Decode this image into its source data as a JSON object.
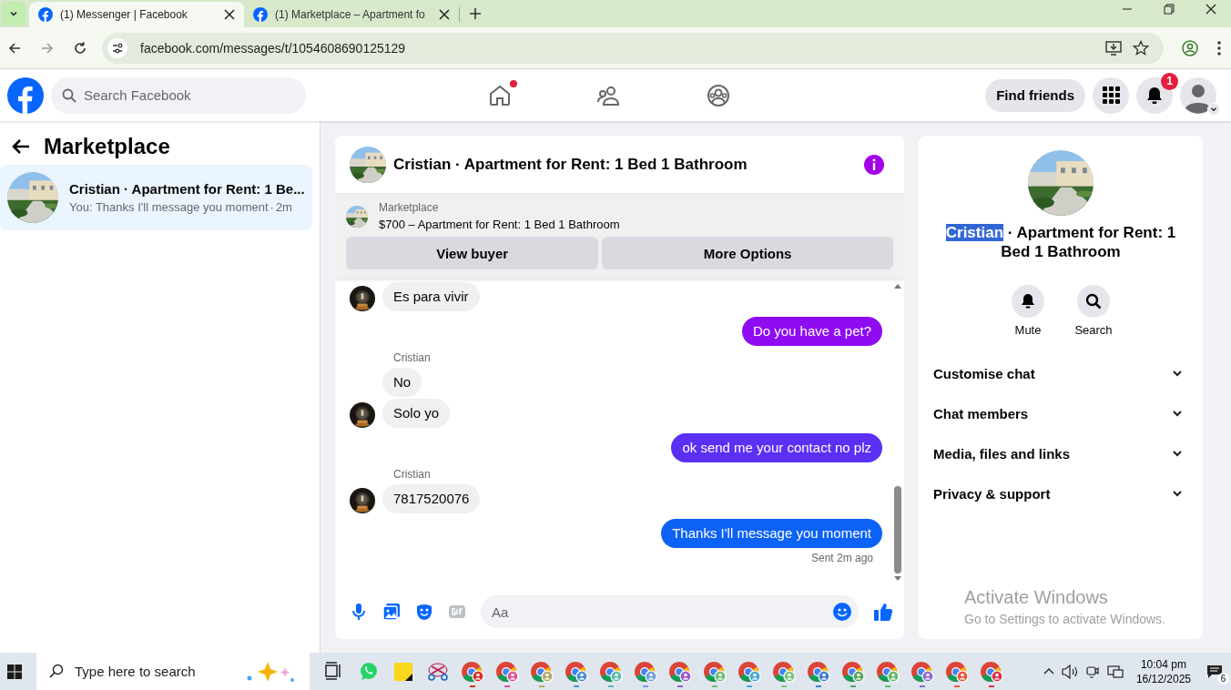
{
  "browser": {
    "tabs": [
      {
        "title": "(1) Messenger | Facebook",
        "selected": true
      },
      {
        "title": "(1) Marketplace – Apartment fo",
        "selected": false
      }
    ],
    "url": "facebook.com/messages/t/1054608690125129"
  },
  "header": {
    "search_placeholder": "Search Facebook",
    "nav": [
      {
        "kind": "home",
        "dot": true
      },
      {
        "kind": "friends",
        "dot": false
      },
      {
        "kind": "groups",
        "dot": false
      }
    ],
    "find_friends": "Find friends",
    "notification_count": "1"
  },
  "sidebar": {
    "title": "Marketplace",
    "conversations": [
      {
        "name": "Cristian · Apartment for Rent: 1 Be...",
        "preview": "You: Thanks I'll message you moment",
        "separator": "·",
        "time": "2m",
        "selected": true
      }
    ]
  },
  "chat": {
    "title": "Cristian · Apartment for Rent: 1 Bed 1 Bathroom",
    "listing": {
      "label": "Marketplace",
      "title": "$700 – Apartment for Rent: 1 Bed 1 Bathroom"
    },
    "buttons": [
      "View buyer",
      "More Options"
    ],
    "messages": [
      {
        "kind": "in",
        "text": "Es para vivir",
        "avatar": true
      },
      {
        "kind": "out",
        "text": "Do you have a pet?",
        "color": "#8f0cf2"
      },
      {
        "kind": "in",
        "sender": "Cristian",
        "text": "No",
        "avatar": false
      },
      {
        "kind": "in",
        "text": "Solo yo",
        "avatar": true
      },
      {
        "kind": "out",
        "text": "ok send me your contact no plz",
        "color": "#5b30f4"
      },
      {
        "kind": "in",
        "sender": "Cristian",
        "text": "7817520076",
        "avatar": true
      },
      {
        "kind": "out",
        "text": "Thanks I'll message you moment",
        "color": "#0d62f6"
      }
    ],
    "sent_status": "Sent 2m ago",
    "composer_placeholder": "Aa"
  },
  "info_panel": {
    "name": "Cristian",
    "name_selected": true,
    "title_rest": " · Apartment for Rent: 1 Bed 1 Bathroom",
    "actions": [
      {
        "kind": "mute",
        "label": "Mute"
      },
      {
        "kind": "search",
        "label": "Search"
      }
    ],
    "sections": [
      {
        "label": "Customise chat",
        "expanded": false
      },
      {
        "label": "Chat members",
        "expanded": false
      },
      {
        "label": "Media, files and links",
        "expanded": false
      },
      {
        "label": "Privacy & support",
        "expanded": false
      }
    ]
  },
  "system_notice": {
    "title": "Activate Windows",
    "text": "Go to Settings to activate Windows."
  },
  "taskbar": {
    "search_placeholder": "Type here to search",
    "apps": [
      {
        "kind": "taskview"
      },
      {
        "kind": "whatsapp"
      },
      {
        "kind": "notes"
      },
      {
        "kind": "snip"
      },
      {
        "kind": "chrome",
        "color": "#d93025"
      },
      {
        "kind": "chrome",
        "color": "#e05299"
      },
      {
        "kind": "chrome",
        "color": "#b8a86a"
      },
      {
        "kind": "chrome",
        "color": "#4a90d9"
      },
      {
        "kind": "chrome",
        "color": "#5fb8b0"
      },
      {
        "kind": "chrome",
        "color": "#6f9fe0"
      },
      {
        "kind": "chrome",
        "color": "#9b59d0"
      },
      {
        "kind": "chrome",
        "color": "#6fbf73"
      },
      {
        "kind": "chrome",
        "color": "#4aa8d8"
      },
      {
        "kind": "chrome",
        "color": "#7cc67f"
      },
      {
        "kind": "chrome",
        "color": "#3f7fd0"
      },
      {
        "kind": "chrome",
        "color": "#58a860"
      },
      {
        "kind": "chrome",
        "color": "#66bb6a"
      },
      {
        "kind": "chrome",
        "color": "#8e6bd6"
      },
      {
        "kind": "chrome",
        "color": "#e6553a"
      },
      {
        "kind": "chrome",
        "color": "#e0304a"
      }
    ],
    "time": "10:04 pm",
    "date": "16/12/2025",
    "notification_count": "6"
  }
}
